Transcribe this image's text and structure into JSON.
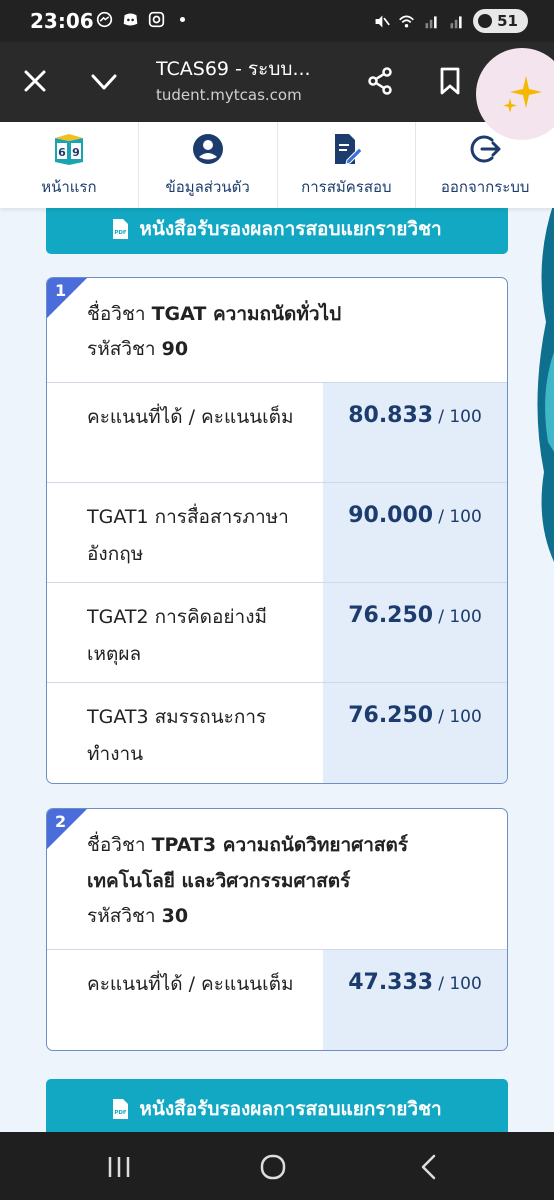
{
  "status_bar": {
    "time": "23:06",
    "battery": "51"
  },
  "browser": {
    "title": "TCAS69 - ระบบ...",
    "url": "tudent.mytcas.com"
  },
  "nav": [
    {
      "label": "หน้าแรก",
      "icon": "book-69-icon"
    },
    {
      "label": "ข้อมูลส่วนตัว",
      "icon": "user-circle-icon"
    },
    {
      "label": "การสมัครสอบ",
      "icon": "document-edit-icon"
    },
    {
      "label": "ออกจากระบบ",
      "icon": "logout-icon"
    }
  ],
  "certificate_button_label": "หนังสือรับรองผลการสอบแยกรายวิชา",
  "pdf_badge": "PDF",
  "subjects": [
    {
      "number": "1",
      "name_prefix": "ชื่อวิชา",
      "name_line1": "TGAT ความถนัดทั่วไป",
      "name_line2": "",
      "code_text": "รหัสวิชา",
      "code": "90",
      "rows": [
        {
          "label": "คะแนนที่ได้ / คะแนนเต็ม",
          "score": "80.833",
          "max": "/ 100"
        },
        {
          "label": "TGAT1 การสื่อสารภาษาอังกฤษ",
          "score": "90.000",
          "max": "/ 100"
        },
        {
          "label": "TGAT2 การคิดอย่างมีเหตุผล",
          "score": "76.250",
          "max": "/ 100"
        },
        {
          "label": "TGAT3 สมรรถนะการทำงาน",
          "score": "76.250",
          "max": "/ 100"
        }
      ]
    },
    {
      "number": "2",
      "name_prefix": "ชื่อวิชา",
      "name_line1": "TPAT3 ความถนัดวิทยาศาสตร์",
      "name_line2": "เทคโนโลยี และวิศวกรรมศาสตร์",
      "code_text": "รหัสวิชา",
      "code": "30",
      "rows": [
        {
          "label": "คะแนนที่ได้ / คะแนนเต็ม",
          "score": "47.333",
          "max": "/ 100"
        }
      ]
    }
  ],
  "colors": {
    "accent": "#12a8c3",
    "navy": "#1d3c6e",
    "corner": "#4b6cdb",
    "score_bg": "#e3ecf9"
  }
}
